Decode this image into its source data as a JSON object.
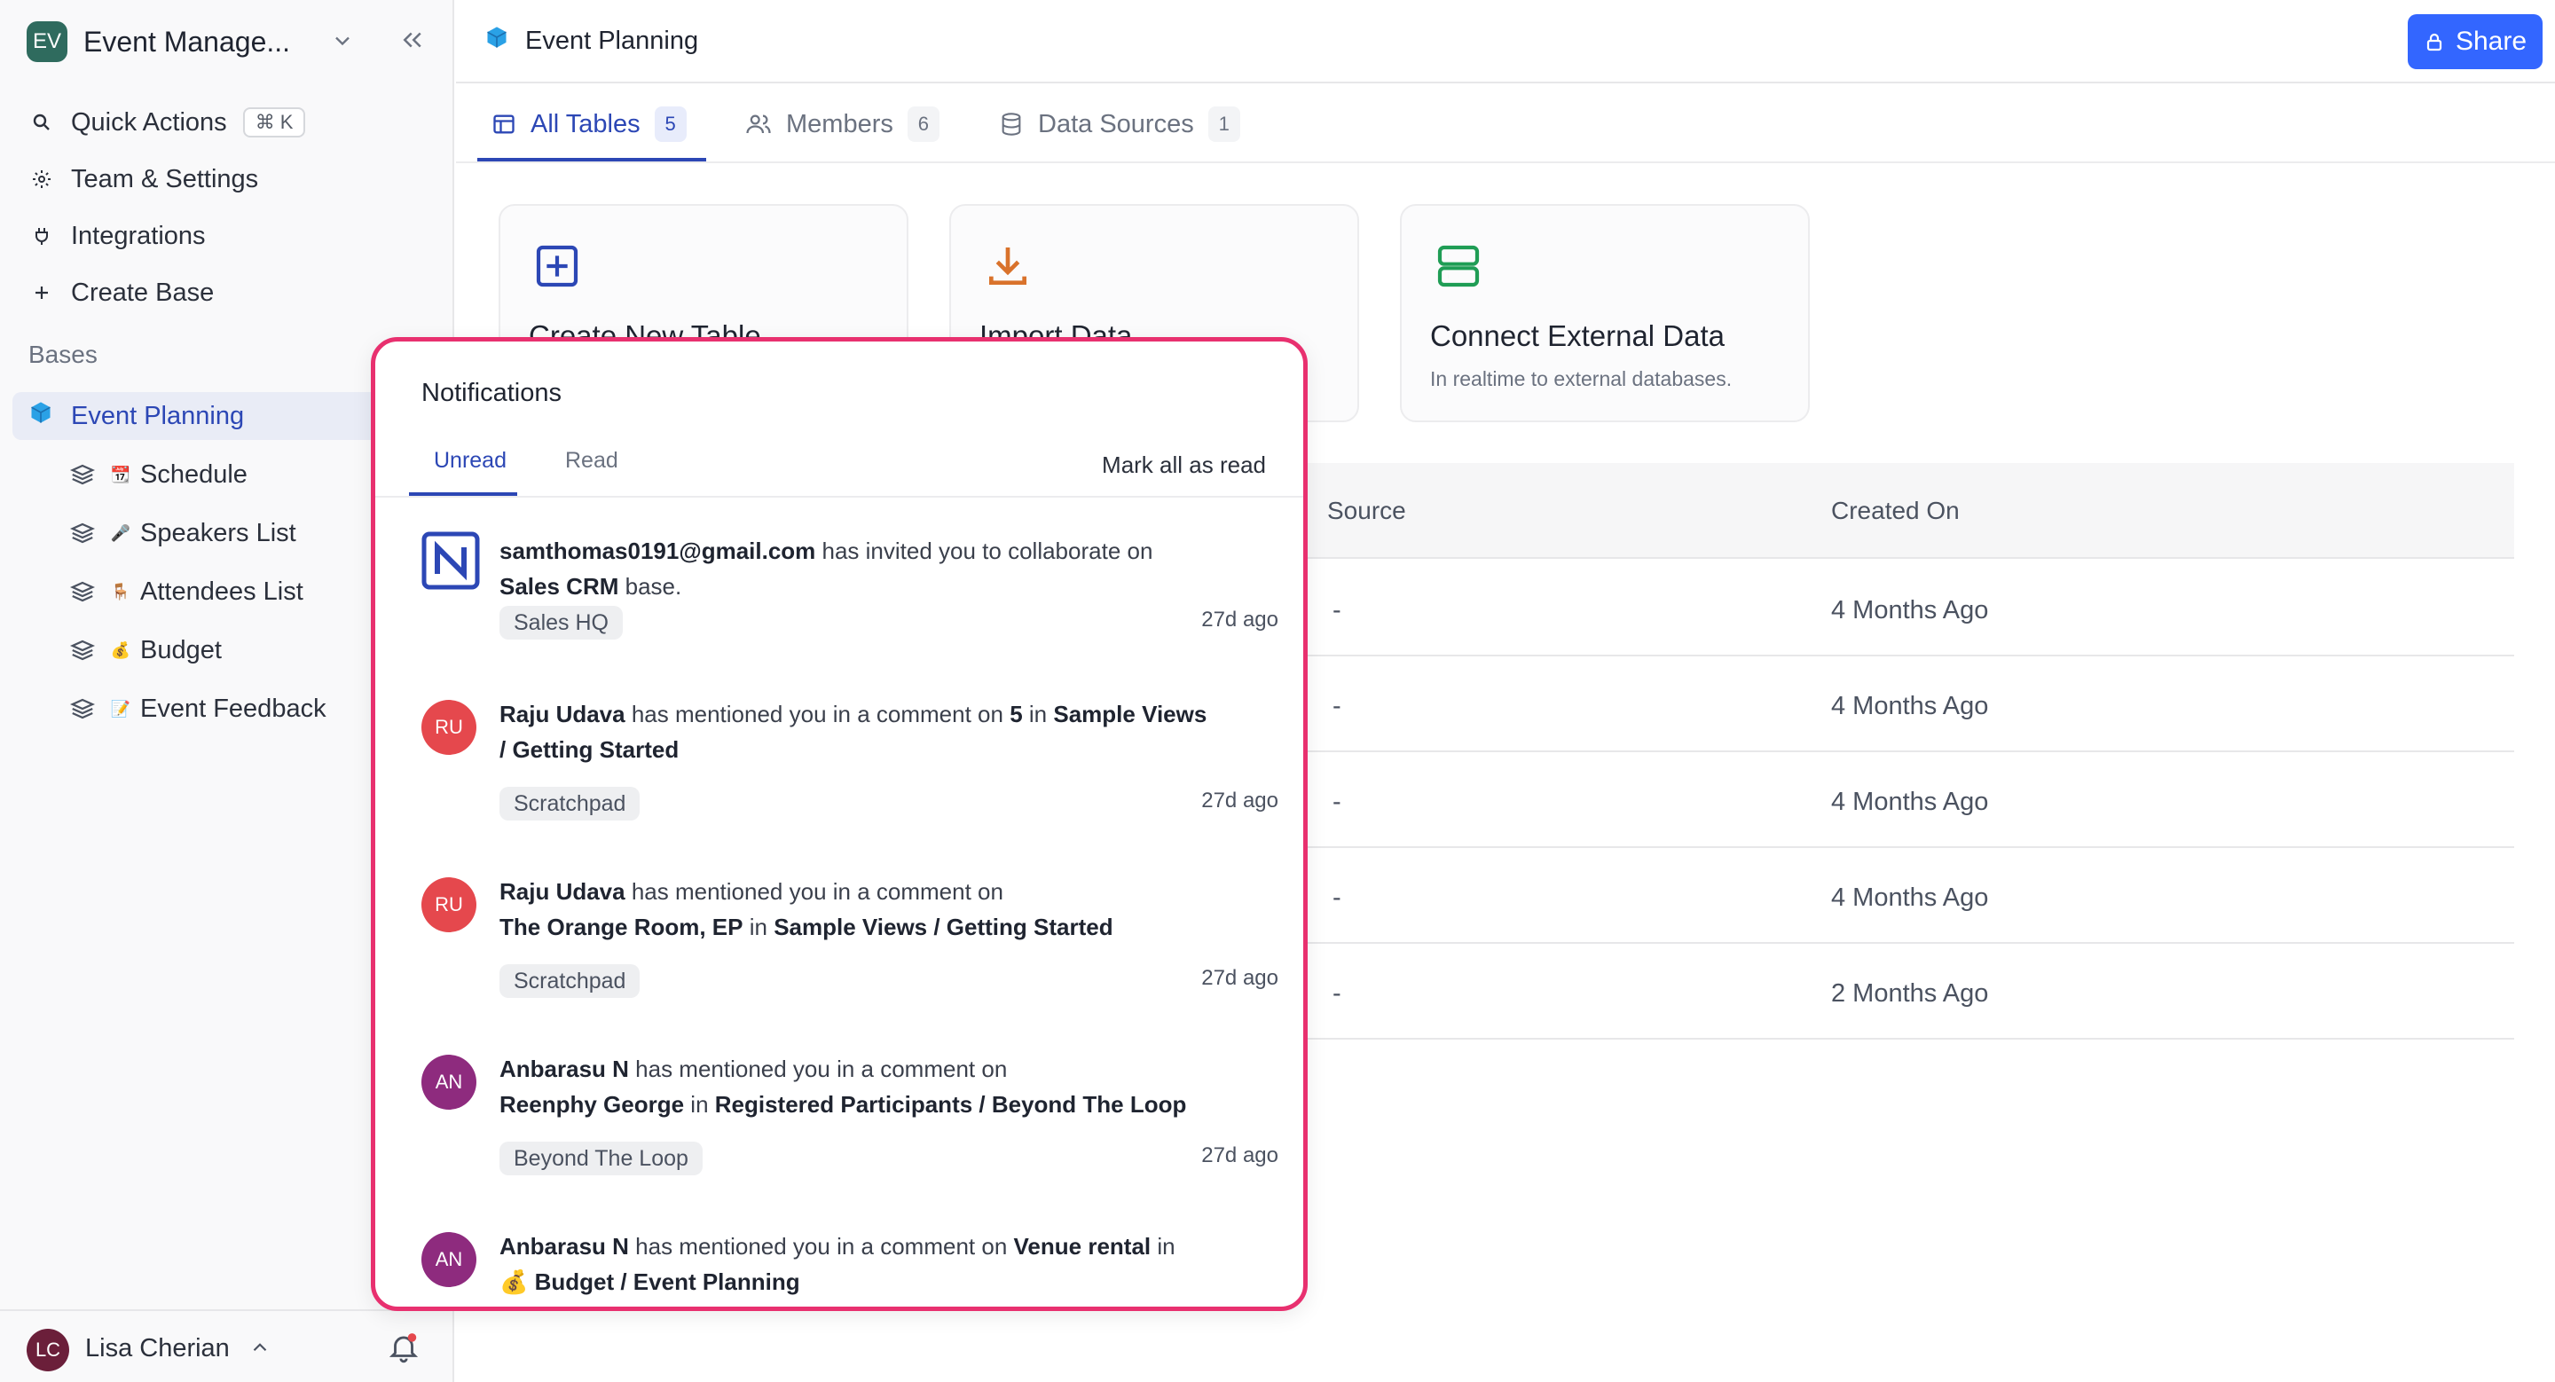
{
  "workspace": {
    "initials": "EV",
    "name": "Event Manage..."
  },
  "sidebar": {
    "items": [
      {
        "label": "Quick Actions",
        "shortcut": "⌘ K"
      },
      {
        "label": "Team & Settings"
      },
      {
        "label": "Integrations"
      },
      {
        "label": "Create Base"
      }
    ],
    "bases_label": "Bases",
    "active_base": "Event Planning",
    "tables": [
      {
        "label": "Schedule",
        "emoji": "📆"
      },
      {
        "label": "Speakers List",
        "emoji": "🎤"
      },
      {
        "label": "Attendees List",
        "emoji": "🪑"
      },
      {
        "label": "Budget",
        "emoji": "💰"
      },
      {
        "label": "Event Feedback",
        "emoji": "📝"
      }
    ]
  },
  "user": {
    "initials": "LC",
    "name": "Lisa Cherian"
  },
  "topbar": {
    "title": "Event Planning",
    "share_label": "Share"
  },
  "tabs": [
    {
      "label": "All Tables",
      "count": "5"
    },
    {
      "label": "Members",
      "count": "6"
    },
    {
      "label": "Data Sources",
      "count": "1"
    }
  ],
  "cards": [
    {
      "title": "Create New Table",
      "subtitle": ""
    },
    {
      "title": "Import Data",
      "subtitle": ""
    },
    {
      "title": "Connect External Data",
      "subtitle": "In realtime to external databases."
    }
  ],
  "table": {
    "columns": [
      "Source",
      "Created On"
    ],
    "rows": [
      {
        "source": "-",
        "created": "4 Months Ago"
      },
      {
        "source": "-",
        "created": "4 Months Ago"
      },
      {
        "source": "-",
        "created": "4 Months Ago"
      },
      {
        "source": "-",
        "created": "4 Months Ago"
      },
      {
        "source": "-",
        "created": "2 Months Ago"
      }
    ]
  },
  "notifications": {
    "title": "Notifications",
    "tab_unread": "Unread",
    "tab_read": "Read",
    "mark_all": "Mark all as read",
    "items": [
      {
        "avatar": "",
        "user": "samthomas0191@gmail.com",
        "action": " has invited you to collaborate on",
        "target": "Sales CRM",
        "suffix": " base.",
        "chip": "Sales HQ",
        "time": "27d ago"
      },
      {
        "avatar": "RU",
        "user": "Raju Udava",
        "action": " has mentioned you in a comment on ",
        "target": "5",
        "mid": " in ",
        "location": "Sample Views / Getting Started",
        "chip": "Scratchpad",
        "time": "27d ago"
      },
      {
        "avatar": "RU",
        "user": "Raju Udava",
        "action": " has mentioned you in a comment on",
        "target": "The Orange Room, EP",
        "mid": " in ",
        "location": "Sample Views / Getting Started",
        "chip": "Scratchpad",
        "time": "27d ago"
      },
      {
        "avatar": "AN",
        "user": "Anbarasu N",
        "action": " has mentioned you in a comment on",
        "target": "Reenphy George",
        "mid": " in ",
        "location": "Registered Participants / Beyond The Loop",
        "chip": "Beyond The Loop",
        "time": "27d ago"
      },
      {
        "avatar": "AN",
        "user": "Anbarasu N",
        "action": " has mentioned you in a comment on ",
        "target": "Venue rental",
        "mid": " in",
        "location": "💰 Budget / Event Planning",
        "chip": "",
        "time": ""
      }
    ]
  },
  "colors": {
    "accent": "#3366ff",
    "primary_text": "#2c47b5",
    "popup_border": "#e8306f",
    "avatar_ru": "#e5484d",
    "avatar_an": "#8e2b7e"
  }
}
